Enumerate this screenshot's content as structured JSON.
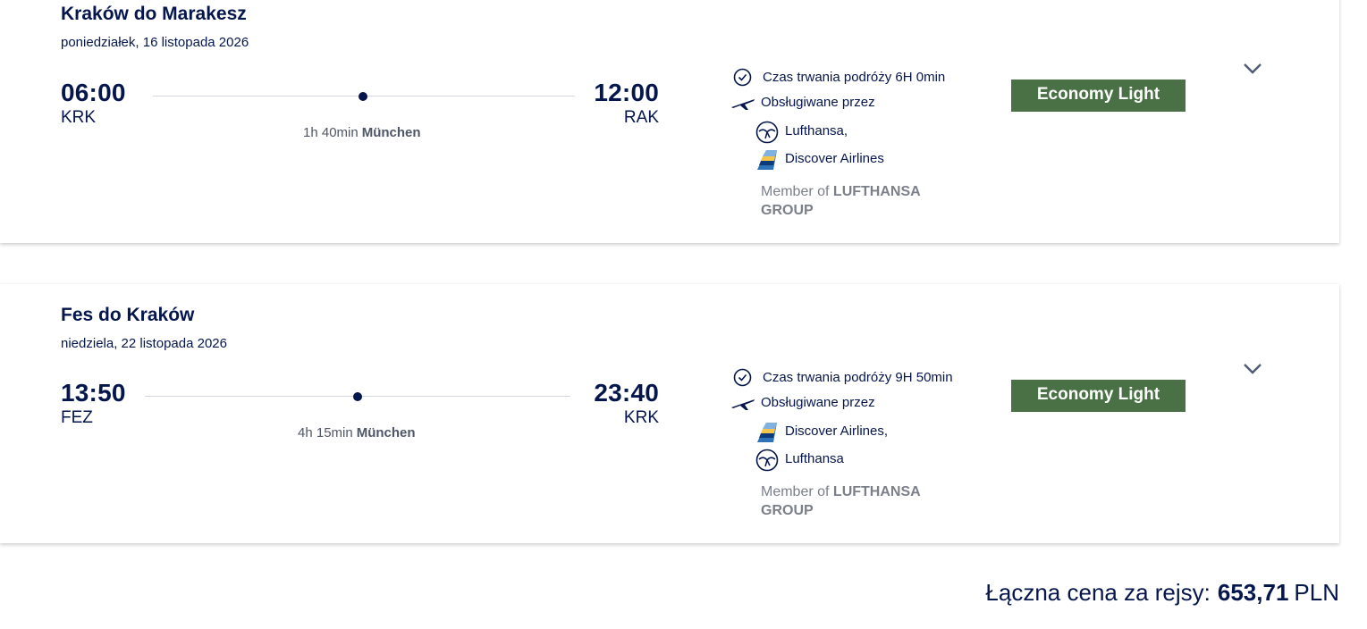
{
  "itinerary": [
    {
      "title": "Kraków do Marakesz",
      "date": "poniedziałek, 16 listopada 2026",
      "departure": {
        "time": "06:00",
        "code": "KRK"
      },
      "arrival": {
        "time": "12:00",
        "code": "RAK"
      },
      "stop": {
        "duration": "1h 40min",
        "city": "München"
      },
      "duration_text": "Czas trwania podróży 6H 0min",
      "operated_by_label": "Obsługiwane przez",
      "carriers": [
        {
          "name": "Lufthansa,",
          "icon": "lufthansa-crane-icon"
        },
        {
          "name": "Discover Airlines",
          "icon": "discover-airlines-tail-icon"
        }
      ],
      "member_prefix": "Member of",
      "member_group_line1": "LUFTHANSA",
      "member_group_line2": "GROUP",
      "fare_label": "Economy Light"
    },
    {
      "title": "Fes do Kraków",
      "date": "niedziela, 22 listopada 2026",
      "departure": {
        "time": "13:50",
        "code": "FEZ"
      },
      "arrival": {
        "time": "23:40",
        "code": "KRK"
      },
      "stop": {
        "duration": "4h 15min",
        "city": "München"
      },
      "duration_text": "Czas trwania podróży 9H 50min",
      "operated_by_label": "Obsługiwane przez",
      "carriers": [
        {
          "name": "Discover Airlines,",
          "icon": "discover-airlines-tail-icon"
        },
        {
          "name": "Lufthansa",
          "icon": "lufthansa-crane-icon"
        }
      ],
      "member_prefix": "Member of",
      "member_group_line1": "LUFTHANSA",
      "member_group_line2": "GROUP",
      "fare_label": "Economy Light"
    }
  ],
  "total": {
    "label": "Łączna cena za rejsy:",
    "amount": "653,71",
    "currency": "PLN"
  },
  "colors": {
    "navy": "#05164d",
    "fare_green": "#4a7045",
    "muted": "#7b7f89"
  },
  "icons": [
    "clock-icon",
    "plane-icon",
    "lufthansa-crane-icon",
    "discover-airlines-tail-icon",
    "chevron-down-icon"
  ]
}
